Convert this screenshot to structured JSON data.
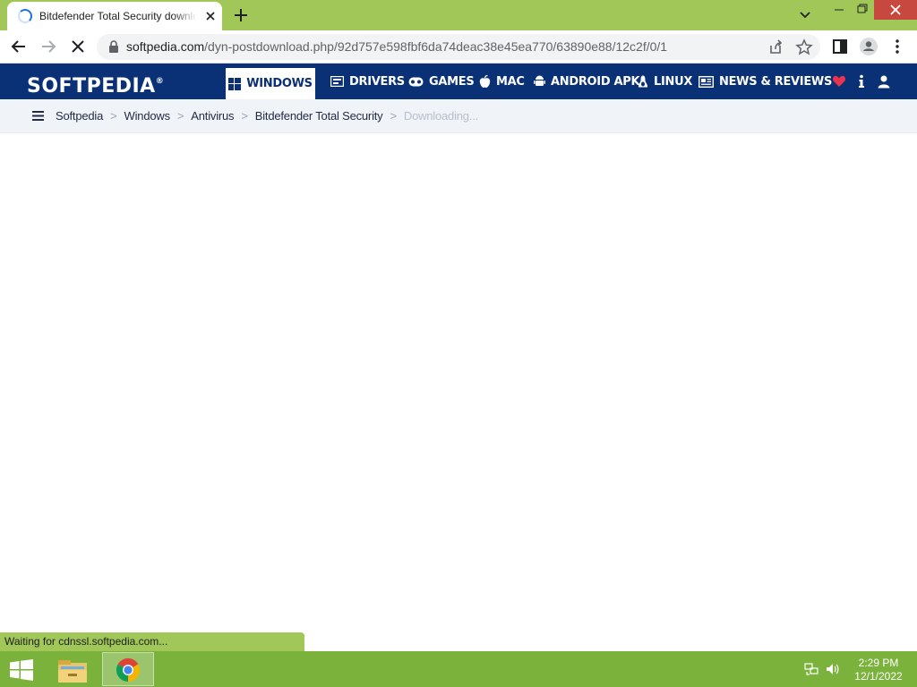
{
  "browser": {
    "tab": {
      "title": "Bitdefender Total Security download"
    },
    "omnibox": {
      "url_host": "softpedia.com",
      "url_path": "/dyn-postdownload.php/92d757e598fbf6da74deac38e45ea770/63890e88/12c2f/0/1"
    },
    "status": "Waiting for cdnssl.softpedia.com..."
  },
  "site": {
    "logo": "SOFTPEDIA",
    "logo_mark": "®",
    "nav": [
      {
        "label": "WINDOWS",
        "icon": "windows-icon",
        "active": true
      },
      {
        "label": "DRIVERS",
        "icon": "drivers-icon"
      },
      {
        "label": "GAMES",
        "icon": "gamepad-icon"
      },
      {
        "label": "MAC",
        "icon": "apple-icon"
      },
      {
        "label": "ANDROID APK",
        "icon": "android-icon"
      },
      {
        "label": "LINUX",
        "icon": "linux-icon"
      },
      {
        "label": "NEWS & REVIEWS",
        "icon": "news-icon"
      }
    ],
    "nav_right_icons": [
      "heart-icon",
      "info-icon",
      "user-icon"
    ],
    "breadcrumb": [
      "Softpedia",
      "Windows",
      "Antivirus",
      "Bitdefender Total Security",
      "Downloading..."
    ],
    "breadcrumb_separator": ">"
  },
  "taskbar": {
    "time": "2:29 PM",
    "date": "12/1/2022"
  },
  "colors": {
    "chrome_frame": "#a1c759",
    "softpedia_nav": "#0a3176",
    "taskbar": "#7ab23b",
    "close_button": "#c7483f"
  }
}
